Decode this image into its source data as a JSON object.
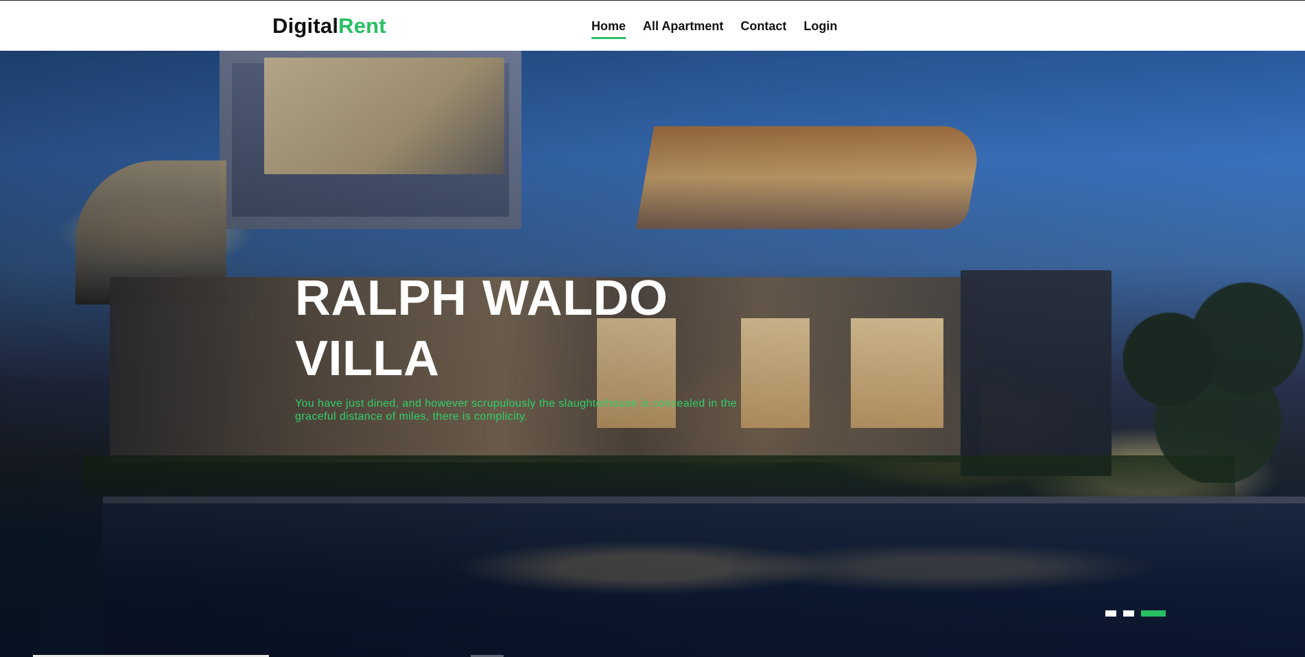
{
  "header": {
    "brand": {
      "primary": "Digital",
      "accent": "Rent"
    },
    "nav": [
      {
        "label": "Home",
        "active": true
      },
      {
        "label": "All Apartment",
        "active": false
      },
      {
        "label": "Contact",
        "active": false
      },
      {
        "label": "Login",
        "active": false
      }
    ]
  },
  "hero": {
    "title": "RALPH WALDO VILLA",
    "subtitle": "You have just dined, and however scrupulously the slaughterhouse is concealed in the graceful distance of miles, there is complicity.",
    "slides": {
      "count": 3,
      "active_index": 2
    }
  },
  "colors": {
    "accent": "#27c063",
    "header_bg": "#ffffff",
    "hero_text": "#ffffff",
    "hero_subtitle": "#2fd16b",
    "text_dark": "#111111"
  }
}
